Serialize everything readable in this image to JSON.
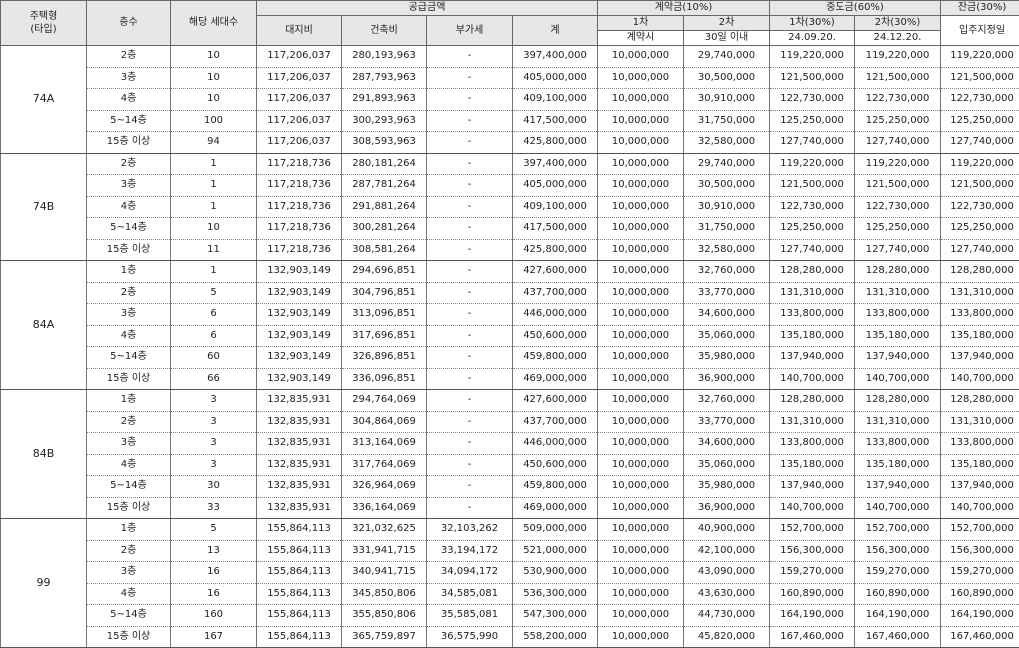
{
  "headers": {
    "type": "주택형\n(타입)",
    "floor": "층수",
    "units": "해당 세대수",
    "supply": "공급금액",
    "land": "대지비",
    "building": "건축비",
    "vat": "부가세",
    "total": "계",
    "deposit": "계약금(10%)",
    "dep1": "1차",
    "dep2": "2차",
    "dep1_when": "계약시",
    "dep2_when": "30일 이내",
    "middle": "중도금(60%)",
    "mid1": "1차(30%)",
    "mid2": "2차(30%)",
    "mid1_date": "24.09.20.",
    "mid2_date": "24.12.20.",
    "balance": "잔금(30%)",
    "balance_when": "입주지정일"
  },
  "groups": [
    {
      "type": "74A",
      "rows": [
        {
          "floor": "2층",
          "units": "10",
          "land": "117,206,037",
          "building": "280,193,963",
          "vat": "-",
          "total": "397,400,000",
          "d1": "10,000,000",
          "d2": "29,740,000",
          "m1": "119,220,000",
          "m2": "119,220,000",
          "bal": "119,220,000"
        },
        {
          "floor": "3층",
          "units": "10",
          "land": "117,206,037",
          "building": "287,793,963",
          "vat": "-",
          "total": "405,000,000",
          "d1": "10,000,000",
          "d2": "30,500,000",
          "m1": "121,500,000",
          "m2": "121,500,000",
          "bal": "121,500,000"
        },
        {
          "floor": "4층",
          "units": "10",
          "land": "117,206,037",
          "building": "291,893,963",
          "vat": "-",
          "total": "409,100,000",
          "d1": "10,000,000",
          "d2": "30,910,000",
          "m1": "122,730,000",
          "m2": "122,730,000",
          "bal": "122,730,000"
        },
        {
          "floor": "5~14층",
          "units": "100",
          "land": "117,206,037",
          "building": "300,293,963",
          "vat": "-",
          "total": "417,500,000",
          "d1": "10,000,000",
          "d2": "31,750,000",
          "m1": "125,250,000",
          "m2": "125,250,000",
          "bal": "125,250,000"
        },
        {
          "floor": "15층 이상",
          "units": "94",
          "land": "117,206,037",
          "building": "308,593,963",
          "vat": "-",
          "total": "425,800,000",
          "d1": "10,000,000",
          "d2": "32,580,000",
          "m1": "127,740,000",
          "m2": "127,740,000",
          "bal": "127,740,000"
        }
      ]
    },
    {
      "type": "74B",
      "rows": [
        {
          "floor": "2층",
          "units": "1",
          "land": "117,218,736",
          "building": "280,181,264",
          "vat": "-",
          "total": "397,400,000",
          "d1": "10,000,000",
          "d2": "29,740,000",
          "m1": "119,220,000",
          "m2": "119,220,000",
          "bal": "119,220,000"
        },
        {
          "floor": "3층",
          "units": "1",
          "land": "117,218,736",
          "building": "287,781,264",
          "vat": "-",
          "total": "405,000,000",
          "d1": "10,000,000",
          "d2": "30,500,000",
          "m1": "121,500,000",
          "m2": "121,500,000",
          "bal": "121,500,000"
        },
        {
          "floor": "4층",
          "units": "1",
          "land": "117,218,736",
          "building": "291,881,264",
          "vat": "-",
          "total": "409,100,000",
          "d1": "10,000,000",
          "d2": "30,910,000",
          "m1": "122,730,000",
          "m2": "122,730,000",
          "bal": "122,730,000"
        },
        {
          "floor": "5~14층",
          "units": "10",
          "land": "117,218,736",
          "building": "300,281,264",
          "vat": "-",
          "total": "417,500,000",
          "d1": "10,000,000",
          "d2": "31,750,000",
          "m1": "125,250,000",
          "m2": "125,250,000",
          "bal": "125,250,000"
        },
        {
          "floor": "15층 이상",
          "units": "11",
          "land": "117,218,736",
          "building": "308,581,264",
          "vat": "-",
          "total": "425,800,000",
          "d1": "10,000,000",
          "d2": "32,580,000",
          "m1": "127,740,000",
          "m2": "127,740,000",
          "bal": "127,740,000"
        }
      ]
    },
    {
      "type": "84A",
      "rows": [
        {
          "floor": "1층",
          "units": "1",
          "land": "132,903,149",
          "building": "294,696,851",
          "vat": "-",
          "total": "427,600,000",
          "d1": "10,000,000",
          "d2": "32,760,000",
          "m1": "128,280,000",
          "m2": "128,280,000",
          "bal": "128,280,000"
        },
        {
          "floor": "2층",
          "units": "5",
          "land": "132,903,149",
          "building": "304,796,851",
          "vat": "-",
          "total": "437,700,000",
          "d1": "10,000,000",
          "d2": "33,770,000",
          "m1": "131,310,000",
          "m2": "131,310,000",
          "bal": "131,310,000"
        },
        {
          "floor": "3층",
          "units": "6",
          "land": "132,903,149",
          "building": "313,096,851",
          "vat": "-",
          "total": "446,000,000",
          "d1": "10,000,000",
          "d2": "34,600,000",
          "m1": "133,800,000",
          "m2": "133,800,000",
          "bal": "133,800,000"
        },
        {
          "floor": "4층",
          "units": "6",
          "land": "132,903,149",
          "building": "317,696,851",
          "vat": "-",
          "total": "450,600,000",
          "d1": "10,000,000",
          "d2": "35,060,000",
          "m1": "135,180,000",
          "m2": "135,180,000",
          "bal": "135,180,000"
        },
        {
          "floor": "5~14층",
          "units": "60",
          "land": "132,903,149",
          "building": "326,896,851",
          "vat": "-",
          "total": "459,800,000",
          "d1": "10,000,000",
          "d2": "35,980,000",
          "m1": "137,940,000",
          "m2": "137,940,000",
          "bal": "137,940,000"
        },
        {
          "floor": "15층 이상",
          "units": "66",
          "land": "132,903,149",
          "building": "336,096,851",
          "vat": "-",
          "total": "469,000,000",
          "d1": "10,000,000",
          "d2": "36,900,000",
          "m1": "140,700,000",
          "m2": "140,700,000",
          "bal": "140,700,000"
        }
      ]
    },
    {
      "type": "84B",
      "rows": [
        {
          "floor": "1층",
          "units": "3",
          "land": "132,835,931",
          "building": "294,764,069",
          "vat": "-",
          "total": "427,600,000",
          "d1": "10,000,000",
          "d2": "32,760,000",
          "m1": "128,280,000",
          "m2": "128,280,000",
          "bal": "128,280,000"
        },
        {
          "floor": "2층",
          "units": "3",
          "land": "132,835,931",
          "building": "304,864,069",
          "vat": "-",
          "total": "437,700,000",
          "d1": "10,000,000",
          "d2": "33,770,000",
          "m1": "131,310,000",
          "m2": "131,310,000",
          "bal": "131,310,000"
        },
        {
          "floor": "3층",
          "units": "3",
          "land": "132,835,931",
          "building": "313,164,069",
          "vat": "-",
          "total": "446,000,000",
          "d1": "10,000,000",
          "d2": "34,600,000",
          "m1": "133,800,000",
          "m2": "133,800,000",
          "bal": "133,800,000"
        },
        {
          "floor": "4층",
          "units": "3",
          "land": "132,835,931",
          "building": "317,764,069",
          "vat": "-",
          "total": "450,600,000",
          "d1": "10,000,000",
          "d2": "35,060,000",
          "m1": "135,180,000",
          "m2": "135,180,000",
          "bal": "135,180,000"
        },
        {
          "floor": "5~14층",
          "units": "30",
          "land": "132,835,931",
          "building": "326,964,069",
          "vat": "-",
          "total": "459,800,000",
          "d1": "10,000,000",
          "d2": "35,980,000",
          "m1": "137,940,000",
          "m2": "137,940,000",
          "bal": "137,940,000"
        },
        {
          "floor": "15층 이상",
          "units": "33",
          "land": "132,835,931",
          "building": "336,164,069",
          "vat": "-",
          "total": "469,000,000",
          "d1": "10,000,000",
          "d2": "36,900,000",
          "m1": "140,700,000",
          "m2": "140,700,000",
          "bal": "140,700,000"
        }
      ]
    },
    {
      "type": "99",
      "rows": [
        {
          "floor": "1층",
          "units": "5",
          "land": "155,864,113",
          "building": "321,032,625",
          "vat": "32,103,262",
          "total": "509,000,000",
          "d1": "10,000,000",
          "d2": "40,900,000",
          "m1": "152,700,000",
          "m2": "152,700,000",
          "bal": "152,700,000"
        },
        {
          "floor": "2층",
          "units": "13",
          "land": "155,864,113",
          "building": "331,941,715",
          "vat": "33,194,172",
          "total": "521,000,000",
          "d1": "10,000,000",
          "d2": "42,100,000",
          "m1": "156,300,000",
          "m2": "156,300,000",
          "bal": "156,300,000"
        },
        {
          "floor": "3층",
          "units": "16",
          "land": "155,864,113",
          "building": "340,941,715",
          "vat": "34,094,172",
          "total": "530,900,000",
          "d1": "10,000,000",
          "d2": "43,090,000",
          "m1": "159,270,000",
          "m2": "159,270,000",
          "bal": "159,270,000"
        },
        {
          "floor": "4층",
          "units": "16",
          "land": "155,864,113",
          "building": "345,850,806",
          "vat": "34,585,081",
          "total": "536,300,000",
          "d1": "10,000,000",
          "d2": "43,630,000",
          "m1": "160,890,000",
          "m2": "160,890,000",
          "bal": "160,890,000"
        },
        {
          "floor": "5~14층",
          "units": "160",
          "land": "155,864,113",
          "building": "355,850,806",
          "vat": "35,585,081",
          "total": "547,300,000",
          "d1": "10,000,000",
          "d2": "44,730,000",
          "m1": "164,190,000",
          "m2": "164,190,000",
          "bal": "164,190,000"
        },
        {
          "floor": "15층 이상",
          "units": "167",
          "land": "155,864,113",
          "building": "365,759,897",
          "vat": "36,575,990",
          "total": "558,200,000",
          "d1": "10,000,000",
          "d2": "45,820,000",
          "m1": "167,460,000",
          "m2": "167,460,000",
          "bal": "167,460,000"
        }
      ]
    }
  ]
}
